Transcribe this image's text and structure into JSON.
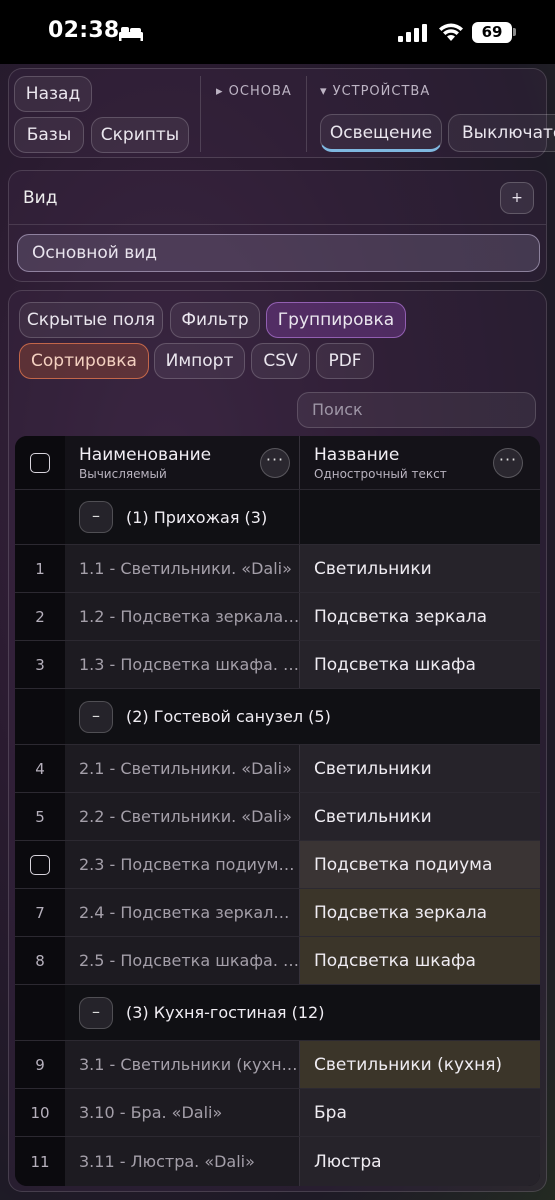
{
  "status_bar": {
    "time": "02:38",
    "battery": "69"
  },
  "top_nav": {
    "buttons": [
      "Назад",
      "Базы",
      "Скрипты"
    ],
    "section_base": "▸ ОСНОВА",
    "section_devices": "▾ УСТРОЙСТВА",
    "tabs": [
      "Освещение",
      "Выключатели"
    ]
  },
  "view": {
    "title": "Вид",
    "plus": "+",
    "selected": "Основной вид"
  },
  "toolbar": {
    "chips": [
      "Скрытые поля",
      "Фильтр",
      "Группировка",
      "Сортировка",
      "Импорт",
      "CSV",
      "PDF"
    ],
    "search_placeholder": "Поиск"
  },
  "table": {
    "columns": [
      {
        "title": "Наименование",
        "subtitle": "Вычисляемый"
      },
      {
        "title": "Название",
        "subtitle": "Однострочный текст"
      }
    ],
    "more": "···",
    "minus": "–",
    "groups": [
      {
        "label": "(1) Прихожая (3)",
        "rows": [
          {
            "num": "1",
            "a": "1.1 - Светильники. «Dali»",
            "b": "Светильники"
          },
          {
            "num": "2",
            "a": "1.2 - Подсветка зеркала…",
            "b": "Подсветка зеркала"
          },
          {
            "num": "3",
            "a": "1.3 - Подсветка шкафа. …",
            "b": "Подсветка шкафа"
          }
        ]
      },
      {
        "label": "(2) Гостевой санузел (5)",
        "rows": [
          {
            "num": "4",
            "a": "2.1 - Светильники. «Dali»",
            "b": "Светильники"
          },
          {
            "num": "5",
            "a": "2.2 - Светильники. «Dali»",
            "b": "Светильники"
          },
          {
            "num": "",
            "a": "2.3 - Подсветка подиум…",
            "b": "Подсветка подиума"
          },
          {
            "num": "7",
            "a": "2.4 - Подсветка зеркал…",
            "b": "Подсветка зеркала"
          },
          {
            "num": "8",
            "a": "2.5 - Подсветка шкафа. …",
            "b": "Подсветка шкафа"
          }
        ]
      },
      {
        "label": "(3) Кухня-гостиная (12)",
        "rows": [
          {
            "num": "9",
            "a": "3.1 - Светильники (кухн…",
            "b": "Светильники (кухня)"
          },
          {
            "num": "10",
            "a": "3.10 - Бра. «Dali»",
            "b": "Бра"
          },
          {
            "num": "11",
            "a": "3.11 - Люстра. «Dali»",
            "b": "Люстра"
          }
        ]
      }
    ]
  }
}
